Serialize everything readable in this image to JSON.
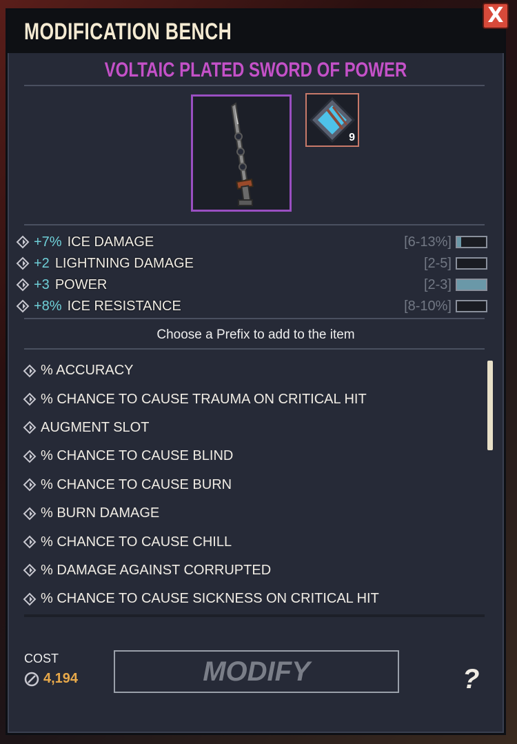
{
  "window": {
    "title": "MODIFICATION BENCH",
    "close_label": "X"
  },
  "item": {
    "name": "VOLTAIC PLATED SWORD OF POWER",
    "rune_count": "9"
  },
  "stats": [
    {
      "value": "+7%",
      "name": "ICE DAMAGE",
      "range": "[6-13%]",
      "fill": 0.14
    },
    {
      "value": "+2",
      "name": "LIGHTNING DAMAGE",
      "range": "[2-5]",
      "fill": 0.0
    },
    {
      "value": "+3",
      "name": "POWER",
      "range": "[2-3]",
      "fill": 1.0
    },
    {
      "value": "+8%",
      "name": "ICE RESISTANCE",
      "range": "[8-10%]",
      "fill": 0.0
    }
  ],
  "prompt": "Choose a Prefix to add to the item",
  "prefix_options": [
    "% ACCURACY",
    "% CHANCE TO CAUSE TRAUMA ON CRITICAL HIT",
    "AUGMENT SLOT",
    "% CHANCE TO CAUSE BLIND",
    "% CHANCE TO CAUSE BURN",
    "% BURN DAMAGE",
    "% CHANCE TO CAUSE CHILL",
    "% DAMAGE AGAINST CORRUPTED",
    "% CHANCE TO CAUSE SICKNESS ON CRITICAL HIT"
  ],
  "cost": {
    "label": "COST",
    "value": "4,194"
  },
  "actions": {
    "modify_label": "MODIFY",
    "help_label": "?"
  },
  "colors": {
    "accent_purple": "#c451c8",
    "stat_value": "#6fd0d8",
    "cost_gold": "#e8a94a",
    "close_red": "#d84a3a"
  }
}
